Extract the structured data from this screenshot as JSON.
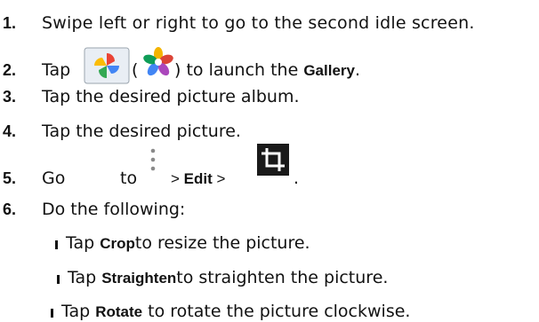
{
  "steps": [
    {
      "number": "1.",
      "text": "Swipe left or right to go to the second idle screen."
    },
    {
      "number": "2.",
      "before": "Tap",
      "paren_open": "(",
      "after": ") to launch the",
      "bold": "Gallery",
      "end": "."
    },
    {
      "number": "3.",
      "text": "Tap the desired picture album."
    },
    {
      "number": "4.",
      "text": "Tap the desired picture."
    },
    {
      "number": "5.",
      "go": "Go",
      "to": "to",
      "sep1": ">",
      "bold": "Edit",
      "sep2": ">",
      "end": "."
    },
    {
      "number": "6.",
      "text": "Do the following:"
    }
  ],
  "sub_items": [
    {
      "before": "Tap",
      "bold": "Crop",
      "after": "to resize the picture."
    },
    {
      "before": "Tap",
      "bold": "Straighten",
      "after": "to straighten the picture."
    },
    {
      "before": "Tap",
      "bold": "Rotate",
      "after": "to rotate the picture clockwise."
    }
  ],
  "icons": {
    "gallery_pinwheel": "photos-pinwheel-icon",
    "gallery_flower": "photos-flower-icon",
    "menu": "more-options-vertical-icon",
    "crop": "crop-icon"
  }
}
